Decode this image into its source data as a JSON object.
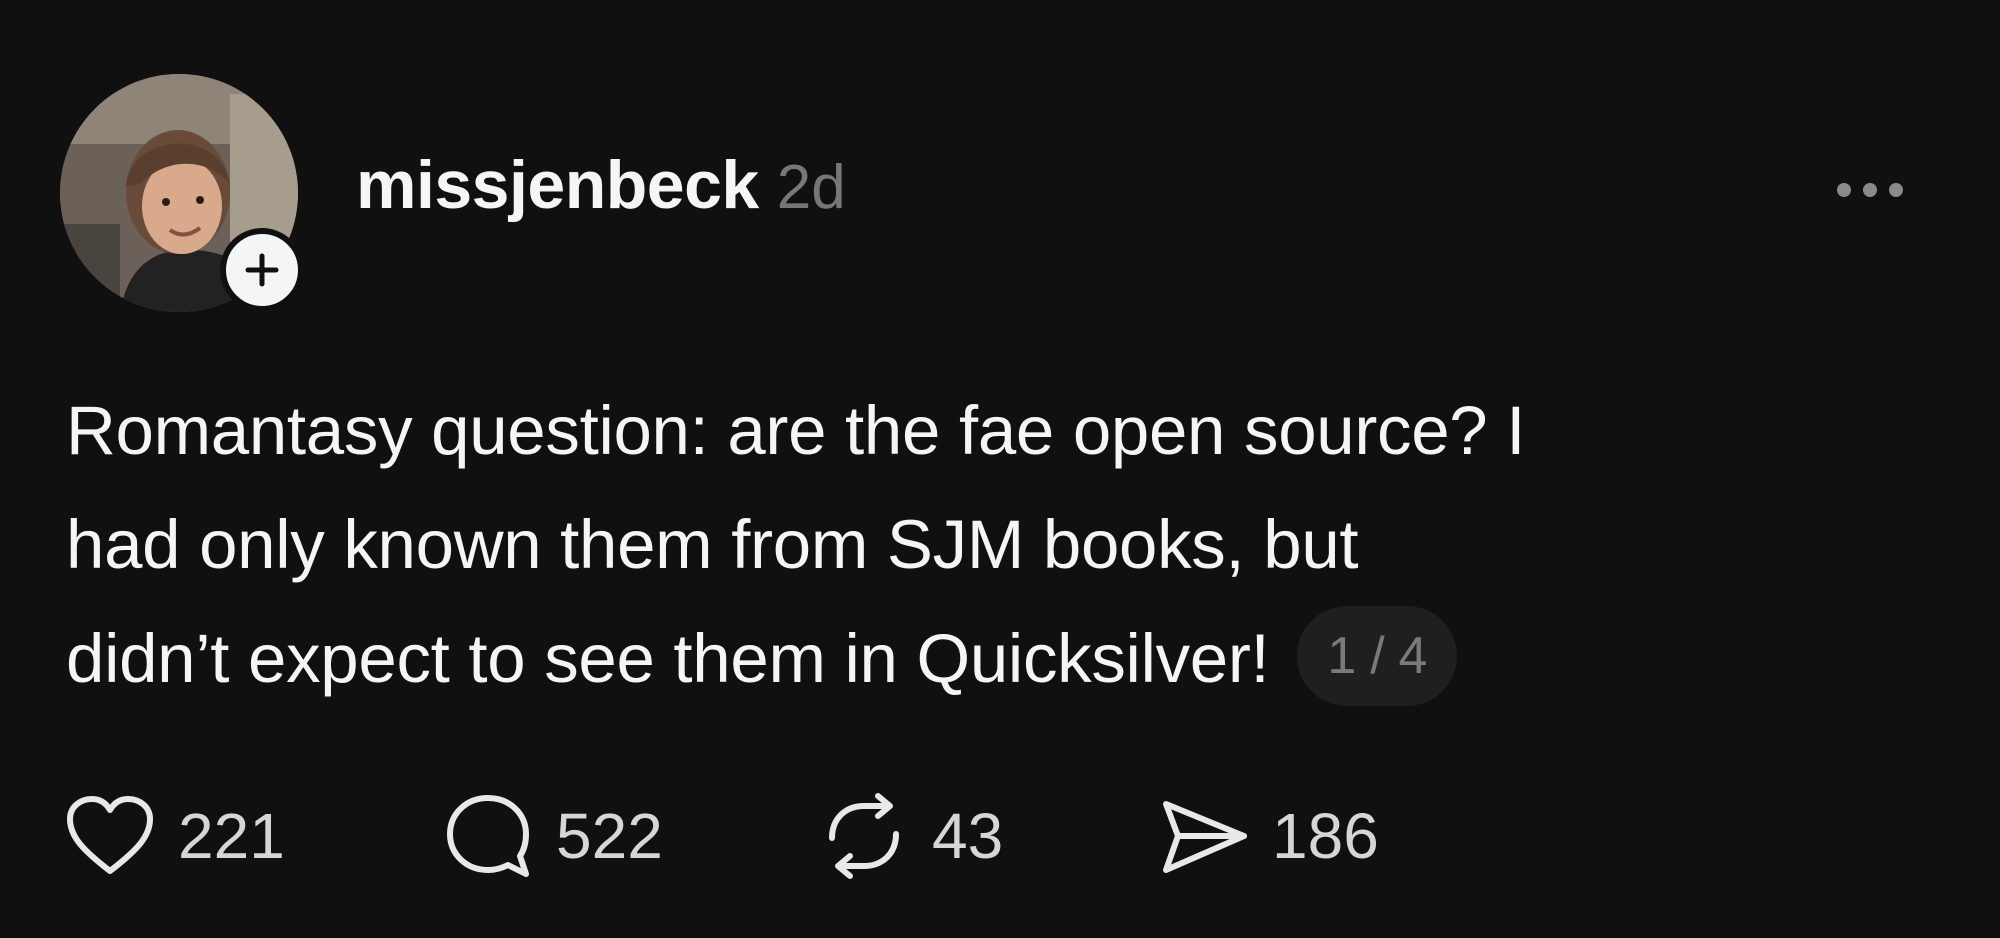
{
  "post": {
    "username": "missjenbeck",
    "timestamp": "2d",
    "text_lines": [
      "Romantasy question: are the fae open source? I",
      "had only known them from SJM books, but",
      "didn’t expect to see them in Quicksilver!"
    ],
    "page_counter": "1 / 4",
    "stats": {
      "likes": "221",
      "replies": "522",
      "reposts": "43",
      "shares": "186"
    },
    "icons": {
      "more": "more-horizontal-icon",
      "follow": "plus-icon",
      "like": "heart-icon",
      "reply": "comment-bubble-icon",
      "repost": "repost-icon",
      "share": "send-icon"
    }
  },
  "colors": {
    "background": "#101010",
    "primary_text": "#f3f5f7",
    "secondary_text": "#777777",
    "pill_background": "#1f1f1f"
  }
}
